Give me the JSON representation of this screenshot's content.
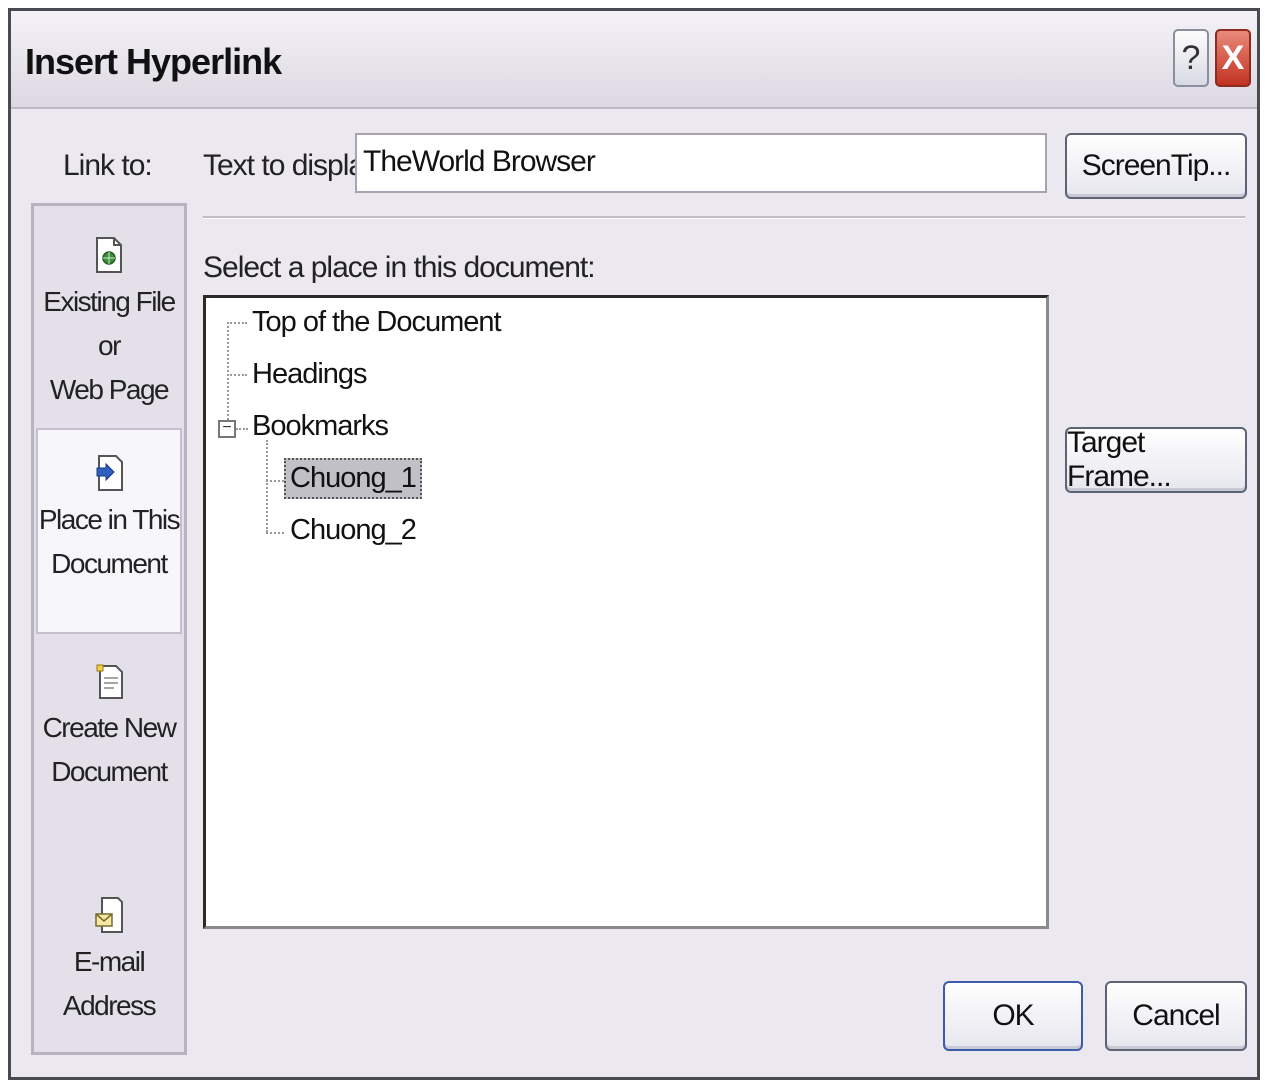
{
  "dialog": {
    "title": "Insert Hyperlink",
    "help_label": "?",
    "close_label": "X"
  },
  "link_to": {
    "label": "Link to:",
    "items": [
      {
        "label": "Existing File or\nWeb Page",
        "icon": "existing-file-icon",
        "selected": false
      },
      {
        "label": "Place in This\nDocument",
        "icon": "place-in-document-icon",
        "selected": true
      },
      {
        "label": "Create New\nDocument",
        "icon": "new-document-icon",
        "selected": false
      },
      {
        "label": "E-mail Address",
        "icon": "email-address-icon",
        "selected": false
      }
    ]
  },
  "text_to_display": {
    "label": "Text to display:",
    "value": "TheWorld Browser"
  },
  "buttons": {
    "screentip": "ScreenTip...",
    "target_frame": "Target Frame...",
    "ok": "OK",
    "cancel": "Cancel"
  },
  "place": {
    "label": "Select a place in this document:",
    "tree": {
      "top": "Top of the Document",
      "headings": "Headings",
      "bookmarks": "Bookmarks",
      "expander": "−",
      "bookmark_items": [
        "Chuong_1",
        "Chuong_2"
      ],
      "selected": "Chuong_1"
    }
  },
  "colors": {
    "dialog_bg": "#ece8f0",
    "selection": "#c0c0c6",
    "close_red": "#c23222"
  }
}
